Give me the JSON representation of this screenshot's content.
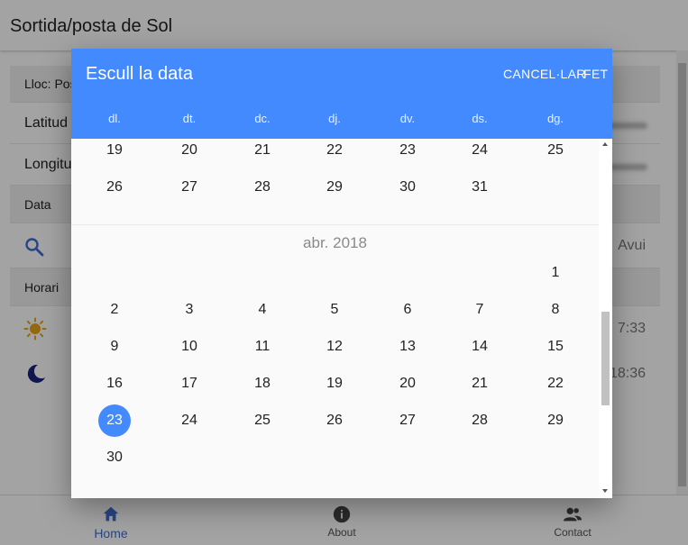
{
  "app": {
    "title": "Sortida/posta de Sol"
  },
  "form": {
    "location_label": "Lloc: Pos",
    "latitude_label": "Latitud",
    "longitude_label": "Longitu",
    "date_section": "Data",
    "today_link": "Avui",
    "schedule_section": "Horari",
    "sunrise_time": "7:33",
    "sunset_time": "18:36"
  },
  "nav": {
    "home": "Home",
    "about": "About",
    "contact": "Contact"
  },
  "dialog": {
    "title": "Escull la data",
    "cancel_label": "CANCEL·LAR",
    "done_label": "FET",
    "weekdays": [
      "dl.",
      "dt.",
      "dc.",
      "dj.",
      "dv.",
      "ds.",
      "dg."
    ],
    "prev_month": {
      "rows": [
        [
          "19",
          "20",
          "21",
          "22",
          "23",
          "24",
          "25"
        ],
        [
          "26",
          "27",
          "28",
          "29",
          "30",
          "31"
        ]
      ]
    },
    "month": {
      "label": "abr. 2018",
      "rows": [
        [
          "",
          "",
          "",
          "",
          "",
          "",
          "1"
        ],
        [
          "2",
          "3",
          "4",
          "5",
          "6",
          "7",
          "8"
        ],
        [
          "9",
          "10",
          "11",
          "12",
          "13",
          "14",
          "15"
        ],
        [
          "16",
          "17",
          "18",
          "19",
          "20",
          "21",
          "22"
        ],
        [
          "23",
          "24",
          "25",
          "26",
          "27",
          "28",
          "29"
        ],
        [
          "30"
        ]
      ],
      "selected": "23"
    }
  },
  "colors": {
    "accent": "#448aff",
    "nav_active": "#3f6ed0",
    "sun": "#e8a317",
    "moon": "#1a237e"
  },
  "icons": [
    "search-icon",
    "sun-icon",
    "moon-icon",
    "home-icon",
    "info-icon",
    "contacts-icon"
  ]
}
